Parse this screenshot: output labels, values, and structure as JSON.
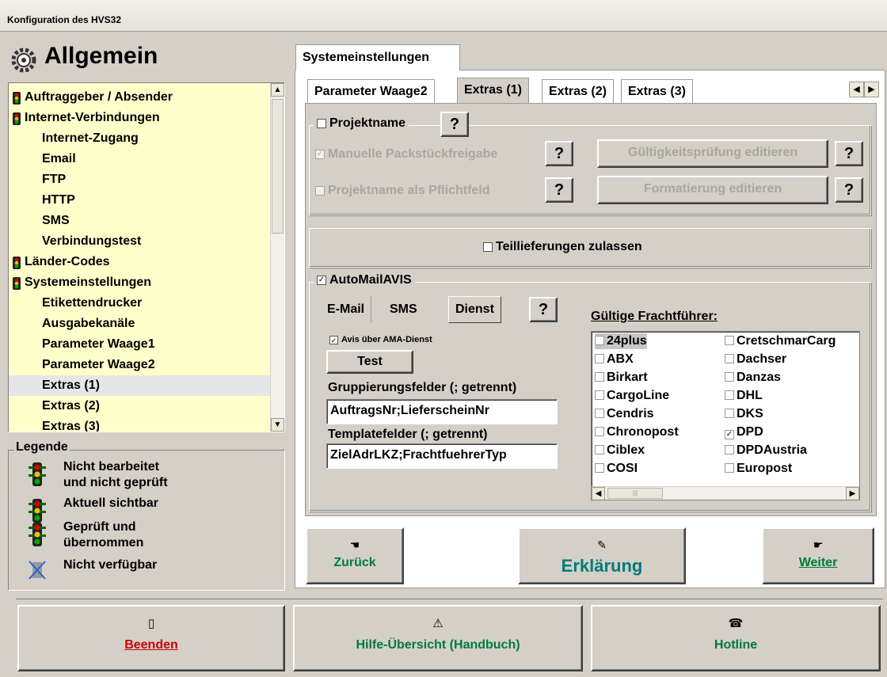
{
  "window": {
    "title": "Konfiguration des HVS32"
  },
  "sidebar": {
    "title": "Allgemein",
    "items": [
      {
        "label": "Auftraggeber / Absender",
        "level": "parent",
        "icon": "traffic-light-icon"
      },
      {
        "label": "Internet-Verbindungen",
        "level": "parent",
        "icon": "traffic-light-icon"
      },
      {
        "label": "Internet-Zugang",
        "level": "child"
      },
      {
        "label": "Email",
        "level": "child"
      },
      {
        "label": "FTP",
        "level": "child"
      },
      {
        "label": "HTTP",
        "level": "child"
      },
      {
        "label": "SMS",
        "level": "child"
      },
      {
        "label": "Verbindungstest",
        "level": "child"
      },
      {
        "label": "Länder-Codes",
        "level": "parent",
        "icon": "traffic-light-icon"
      },
      {
        "label": "Systemeinstellungen",
        "level": "parent",
        "icon": "traffic-light-icon"
      },
      {
        "label": "Etikettendrucker",
        "level": "child"
      },
      {
        "label": "Ausgabekanäle",
        "level": "child"
      },
      {
        "label": "Parameter Waage1",
        "level": "child"
      },
      {
        "label": "Parameter Waage2",
        "level": "child"
      },
      {
        "label": "Extras (1)",
        "level": "child",
        "selected": true
      },
      {
        "label": "Extras (2)",
        "level": "child"
      },
      {
        "label": "Extras (3)",
        "level": "child"
      }
    ]
  },
  "legend": {
    "title": "Legende",
    "items": [
      {
        "line1": "Nicht bearbeitet",
        "line2": "und nicht geprüft"
      },
      {
        "line1": "Aktuell sichtbar",
        "line2": ""
      },
      {
        "line1": "Geprüft und",
        "line2": "übernommen"
      },
      {
        "line1": "Nicht verfügbar",
        "line2": ""
      }
    ]
  },
  "main": {
    "top_tab": "Systemeinstellungen",
    "subtabs": [
      "Parameter Waage2",
      "Extras (1)",
      "Extras (2)",
      "Extras (3)"
    ],
    "active_subtab": "Extras (1)",
    "projekt": {
      "checkbox_label": "Projektname",
      "help": "?",
      "manual_label": "Manuelle Packstückfreigabe",
      "manual_checked": true,
      "pflicht_label": "Projektname als Pflichtfeld",
      "pflicht_checked": false,
      "validate_btn": "Gültigkeitsprüfung editieren",
      "format_btn": "Formatierung editieren"
    },
    "teillieferungen": {
      "label": "Teillieferungen zulassen",
      "checked": false
    },
    "automail": {
      "label": "AutoMailAVIS",
      "checked": true,
      "tabs": [
        "E-Mail",
        "SMS",
        "Dienst"
      ],
      "active_tab": "Dienst",
      "help": "?",
      "avis_label": "Avis über AMA-Dienst",
      "avis_checked": true,
      "test_btn": "Test",
      "grouping_label": "Gruppierungsfelder (; getrennt)",
      "grouping_value": "AuftragsNr;LieferscheinNr",
      "template_label": "Templatefelder (; getrennt)",
      "template_value": "ZielAdrLKZ;FrachtfuehrerTyp",
      "carriers_label": "Gültige Frachtführer:",
      "carriers_col1": [
        {
          "name": "24plus",
          "checked": false,
          "selected": true
        },
        {
          "name": "ABX",
          "checked": false
        },
        {
          "name": "Birkart",
          "checked": false
        },
        {
          "name": "CargoLine",
          "checked": false
        },
        {
          "name": "Cendris",
          "checked": false
        },
        {
          "name": "Chronopost",
          "checked": false
        },
        {
          "name": "Ciblex",
          "checked": false
        },
        {
          "name": "COSI",
          "checked": false
        }
      ],
      "carriers_col2": [
        {
          "name": "CretschmarCarg",
          "checked": false
        },
        {
          "name": "Dachser",
          "checked": false
        },
        {
          "name": "Danzas",
          "checked": false
        },
        {
          "name": "DHL",
          "checked": false
        },
        {
          "name": "DKS",
          "checked": false
        },
        {
          "name": "DPD",
          "checked": true
        },
        {
          "name": "DPDAustria",
          "checked": false
        },
        {
          "name": "Europost",
          "checked": false
        }
      ]
    },
    "nav": {
      "back": "Zurück",
      "explain": "Erklärung",
      "next": "Weiter"
    }
  },
  "bottom": {
    "quit": "Beenden",
    "help": "Hilfe-Übersicht (Handbuch)",
    "hotline": "Hotline"
  },
  "colors": {
    "tree_bg": "#ffffcc",
    "nav_green": "#007a3a",
    "explain_teal": "#007b7b",
    "quit_red": "#cc0000"
  }
}
